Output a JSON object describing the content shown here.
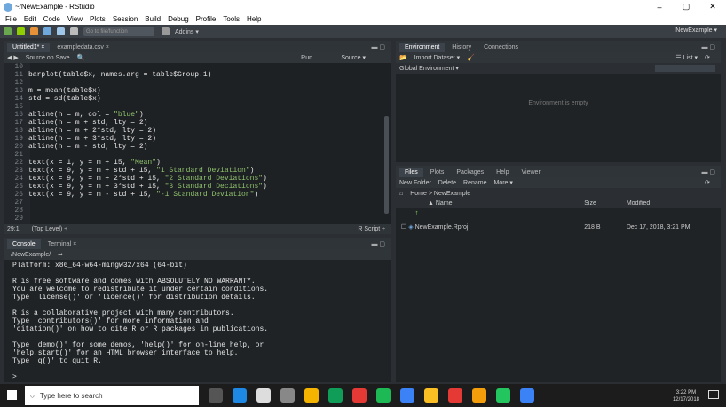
{
  "window": {
    "title": "~/NewExample - RStudio",
    "minimize": "–",
    "maximize": "▢",
    "close": "✕"
  },
  "menu": [
    "File",
    "Edit",
    "Code",
    "View",
    "Plots",
    "Session",
    "Build",
    "Debug",
    "Profile",
    "Tools",
    "Help"
  ],
  "toolbar": {
    "goto_placeholder": "Go to file/function",
    "addins": "Addins ▾",
    "project": "NewExample ▾"
  },
  "source_pane": {
    "tabs": [
      "Untitled1* ×",
      "exampledata.csv ×"
    ],
    "source_on_save": "Source on Save",
    "run": "Run",
    "source": "Source ▾",
    "lines": [
      {
        "n": "10",
        "text": ""
      },
      {
        "n": "11",
        "text": "barplot(table$x, names.arg = table$Group.1)"
      },
      {
        "n": "12",
        "text": ""
      },
      {
        "n": "13",
        "text": "m = mean(table$x)"
      },
      {
        "n": "14",
        "text": "std = sd(table$x)"
      },
      {
        "n": "15",
        "text": ""
      },
      {
        "n": "16",
        "text": "abline(h = m, col = \"blue\")"
      },
      {
        "n": "17",
        "text": "abline(h = m + std, lty = 2)"
      },
      {
        "n": "18",
        "text": "abline(h = m + 2*std, lty = 2)"
      },
      {
        "n": "19",
        "text": "abline(h = m + 3*std, lty = 2)"
      },
      {
        "n": "20",
        "text": "abline(h = m - std, lty = 2)"
      },
      {
        "n": "21",
        "text": ""
      },
      {
        "n": "22",
        "text": "text(x = 1, y = m + 15, \"Mean\")"
      },
      {
        "n": "23",
        "text": "text(x = 9, y = m + std + 15, \"1 Standard Deviation\")"
      },
      {
        "n": "24",
        "text": "text(x = 9, y = m + 2*std + 15, \"2 Standard Deviations\")"
      },
      {
        "n": "25",
        "text": "text(x = 9, y = m + 3*std + 15, \"3 Standard Deciations\")"
      },
      {
        "n": "26",
        "text": "text(x = 9, y = m - std + 15, \"-1 Standard Deviation\")"
      },
      {
        "n": "27",
        "text": ""
      },
      {
        "n": "28",
        "text": ""
      },
      {
        "n": "29",
        "text": ""
      }
    ],
    "status_pos": "29:1",
    "status_level": "(Top Level) ÷",
    "status_type": "R Script ÷"
  },
  "console_pane": {
    "tabs": [
      "Console",
      "Terminal ×"
    ],
    "path": "~/NewExample/",
    "lines": [
      "Platform: x86_64-w64-mingw32/x64 (64-bit)",
      "",
      "R is free software and comes with ABSOLUTELY NO WARRANTY.",
      "You are welcome to redistribute it under certain conditions.",
      "Type 'license()' or 'licence()' for distribution details.",
      "",
      "R is a collaborative project with many contributors.",
      "Type 'contributors()' for more information and",
      "'citation()' on how to cite R or R packages in publications.",
      "",
      "Type 'demo()' for some demos, 'help()' for on-line help, or",
      "'help.start()' for an HTML browser interface to help.",
      "Type 'q()' to quit R.",
      "",
      ">"
    ]
  },
  "env_pane": {
    "tabs": [
      "Environment",
      "History",
      "Connections"
    ],
    "import_dataset": "Import Dataset ▾",
    "list": "☰ List ▾",
    "scope": "Global Environment ▾",
    "empty_msg": "Environment is empty"
  },
  "files_pane": {
    "tabs": [
      "Files",
      "Plots",
      "Packages",
      "Help",
      "Viewer"
    ],
    "new_folder": "New Folder",
    "delete": "Delete",
    "rename": "Rename",
    "more": "More ▾",
    "breadcrumb": "Home > NewExample",
    "col_name": "▲ Name",
    "col_size": "Size",
    "col_modified": "Modified",
    "up": "..",
    "rows": [
      {
        "name": "NewExample.Rproj",
        "size": "218 B",
        "modified": "Dec 17, 2018, 3:21 PM"
      }
    ]
  },
  "taskbar": {
    "search_placeholder": "Type here to search",
    "time": "3:22 PM",
    "date": "12/17/2018",
    "progress_fraction": 0.29
  },
  "colors": {
    "accent_green": "#22c55e",
    "editor_bg": "#1e2124",
    "string": "#8fc26c"
  }
}
